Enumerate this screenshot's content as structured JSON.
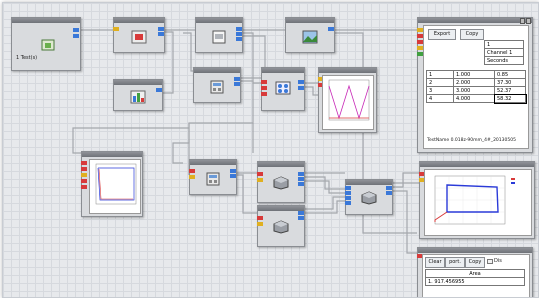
{
  "node_titles": {
    "n1": "",
    "n2": "",
    "n3": "",
    "n4": "",
    "n5": "",
    "n6": "",
    "n7": "",
    "n8": "",
    "n9": "",
    "n10": "",
    "n11": "",
    "n12": "",
    "n13": "",
    "n14": "",
    "n15": "",
    "n16": "",
    "n17": "",
    "n18": ""
  },
  "source_node": {
    "label": "1 Test(s)"
  },
  "table_node": {
    "export_label": "Export",
    "copy_label": "Copy",
    "header": [
      "1",
      "Channel 1",
      "Seconds"
    ],
    "rows": [
      [
        "1",
        "1.000",
        "0.85"
      ],
      [
        "2",
        "2.000",
        "37.30"
      ],
      [
        "3",
        "3.000",
        "52.37"
      ],
      [
        "4",
        "4.000",
        "58.32"
      ]
    ],
    "footer": "TestName   0.018z-90mm_4#_20130505"
  },
  "area_node": {
    "clear_label": "Clear",
    "export_label": "port.",
    "copy_label": "Copy",
    "dis_label": "Dis",
    "header": "Area",
    "value": "1. 917.456955"
  },
  "colors": {
    "pin_blue": "#3a78d8",
    "pin_red": "#d83a3a",
    "pin_yellow": "#e0b020",
    "wire": "#a4a7ac",
    "plot_red": "#d83a3a",
    "plot_blue": "#2a3ad8",
    "plot_magenta": "#c82ab8"
  }
}
